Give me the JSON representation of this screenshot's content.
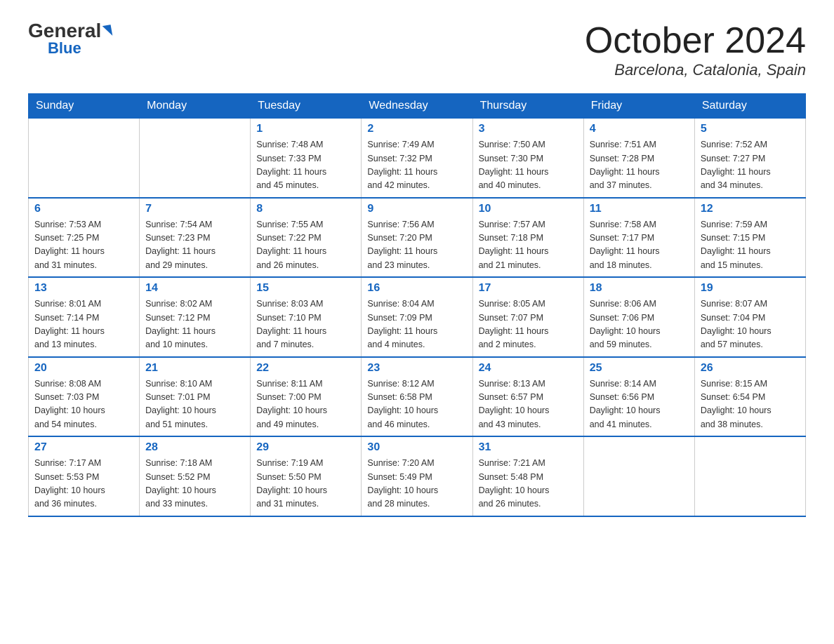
{
  "header": {
    "logo_general": "General",
    "logo_blue": "Blue",
    "month_title": "October 2024",
    "location": "Barcelona, Catalonia, Spain"
  },
  "days_of_week": [
    "Sunday",
    "Monday",
    "Tuesday",
    "Wednesday",
    "Thursday",
    "Friday",
    "Saturday"
  ],
  "weeks": [
    [
      {
        "day": "",
        "info": ""
      },
      {
        "day": "",
        "info": ""
      },
      {
        "day": "1",
        "info": "Sunrise: 7:48 AM\nSunset: 7:33 PM\nDaylight: 11 hours\nand 45 minutes."
      },
      {
        "day": "2",
        "info": "Sunrise: 7:49 AM\nSunset: 7:32 PM\nDaylight: 11 hours\nand 42 minutes."
      },
      {
        "day": "3",
        "info": "Sunrise: 7:50 AM\nSunset: 7:30 PM\nDaylight: 11 hours\nand 40 minutes."
      },
      {
        "day": "4",
        "info": "Sunrise: 7:51 AM\nSunset: 7:28 PM\nDaylight: 11 hours\nand 37 minutes."
      },
      {
        "day": "5",
        "info": "Sunrise: 7:52 AM\nSunset: 7:27 PM\nDaylight: 11 hours\nand 34 minutes."
      }
    ],
    [
      {
        "day": "6",
        "info": "Sunrise: 7:53 AM\nSunset: 7:25 PM\nDaylight: 11 hours\nand 31 minutes."
      },
      {
        "day": "7",
        "info": "Sunrise: 7:54 AM\nSunset: 7:23 PM\nDaylight: 11 hours\nand 29 minutes."
      },
      {
        "day": "8",
        "info": "Sunrise: 7:55 AM\nSunset: 7:22 PM\nDaylight: 11 hours\nand 26 minutes."
      },
      {
        "day": "9",
        "info": "Sunrise: 7:56 AM\nSunset: 7:20 PM\nDaylight: 11 hours\nand 23 minutes."
      },
      {
        "day": "10",
        "info": "Sunrise: 7:57 AM\nSunset: 7:18 PM\nDaylight: 11 hours\nand 21 minutes."
      },
      {
        "day": "11",
        "info": "Sunrise: 7:58 AM\nSunset: 7:17 PM\nDaylight: 11 hours\nand 18 minutes."
      },
      {
        "day": "12",
        "info": "Sunrise: 7:59 AM\nSunset: 7:15 PM\nDaylight: 11 hours\nand 15 minutes."
      }
    ],
    [
      {
        "day": "13",
        "info": "Sunrise: 8:01 AM\nSunset: 7:14 PM\nDaylight: 11 hours\nand 13 minutes."
      },
      {
        "day": "14",
        "info": "Sunrise: 8:02 AM\nSunset: 7:12 PM\nDaylight: 11 hours\nand 10 minutes."
      },
      {
        "day": "15",
        "info": "Sunrise: 8:03 AM\nSunset: 7:10 PM\nDaylight: 11 hours\nand 7 minutes."
      },
      {
        "day": "16",
        "info": "Sunrise: 8:04 AM\nSunset: 7:09 PM\nDaylight: 11 hours\nand 4 minutes."
      },
      {
        "day": "17",
        "info": "Sunrise: 8:05 AM\nSunset: 7:07 PM\nDaylight: 11 hours\nand 2 minutes."
      },
      {
        "day": "18",
        "info": "Sunrise: 8:06 AM\nSunset: 7:06 PM\nDaylight: 10 hours\nand 59 minutes."
      },
      {
        "day": "19",
        "info": "Sunrise: 8:07 AM\nSunset: 7:04 PM\nDaylight: 10 hours\nand 57 minutes."
      }
    ],
    [
      {
        "day": "20",
        "info": "Sunrise: 8:08 AM\nSunset: 7:03 PM\nDaylight: 10 hours\nand 54 minutes."
      },
      {
        "day": "21",
        "info": "Sunrise: 8:10 AM\nSunset: 7:01 PM\nDaylight: 10 hours\nand 51 minutes."
      },
      {
        "day": "22",
        "info": "Sunrise: 8:11 AM\nSunset: 7:00 PM\nDaylight: 10 hours\nand 49 minutes."
      },
      {
        "day": "23",
        "info": "Sunrise: 8:12 AM\nSunset: 6:58 PM\nDaylight: 10 hours\nand 46 minutes."
      },
      {
        "day": "24",
        "info": "Sunrise: 8:13 AM\nSunset: 6:57 PM\nDaylight: 10 hours\nand 43 minutes."
      },
      {
        "day": "25",
        "info": "Sunrise: 8:14 AM\nSunset: 6:56 PM\nDaylight: 10 hours\nand 41 minutes."
      },
      {
        "day": "26",
        "info": "Sunrise: 8:15 AM\nSunset: 6:54 PM\nDaylight: 10 hours\nand 38 minutes."
      }
    ],
    [
      {
        "day": "27",
        "info": "Sunrise: 7:17 AM\nSunset: 5:53 PM\nDaylight: 10 hours\nand 36 minutes."
      },
      {
        "day": "28",
        "info": "Sunrise: 7:18 AM\nSunset: 5:52 PM\nDaylight: 10 hours\nand 33 minutes."
      },
      {
        "day": "29",
        "info": "Sunrise: 7:19 AM\nSunset: 5:50 PM\nDaylight: 10 hours\nand 31 minutes."
      },
      {
        "day": "30",
        "info": "Sunrise: 7:20 AM\nSunset: 5:49 PM\nDaylight: 10 hours\nand 28 minutes."
      },
      {
        "day": "31",
        "info": "Sunrise: 7:21 AM\nSunset: 5:48 PM\nDaylight: 10 hours\nand 26 minutes."
      },
      {
        "day": "",
        "info": ""
      },
      {
        "day": "",
        "info": ""
      }
    ]
  ]
}
